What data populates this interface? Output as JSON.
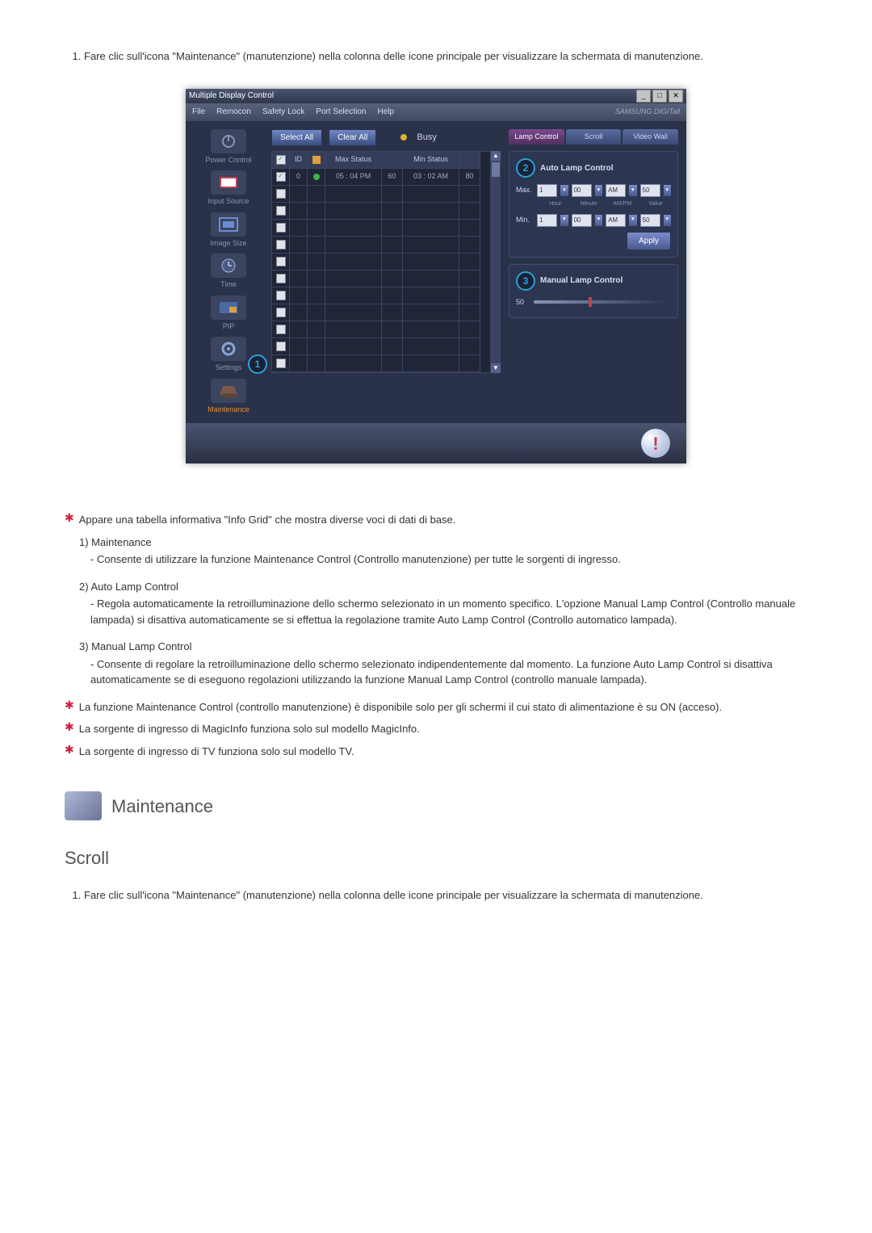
{
  "intro_steps": [
    "Fare clic sull'icona \"Maintenance\" (manutenzione) nella colonna delle icone principale per visualizzare la schermata di manutenzione."
  ],
  "app": {
    "title": "Multiple Display Control",
    "menus": [
      "File",
      "Remocon",
      "Safety Lock",
      "Port Selection",
      "Help"
    ],
    "brand": "SAMSUNG DIGITall"
  },
  "sidebar": {
    "items": [
      {
        "label": "Power Control"
      },
      {
        "label": "Input Source"
      },
      {
        "label": "Image Size"
      },
      {
        "label": "Time"
      },
      {
        "label": "PIP"
      },
      {
        "label": "Settings"
      },
      {
        "label": "Maintenance"
      }
    ]
  },
  "toolbar": {
    "select_all": "Select All",
    "clear_all": "Clear All",
    "busy": "Busy"
  },
  "grid": {
    "headers": {
      "check": "",
      "id": "ID",
      "stat": "",
      "maxstat": "Max Status",
      "maxval": "",
      "minstat": "Min Status",
      "minval": ""
    },
    "row1": {
      "id": "0",
      "maxstat": "05 : 04 PM",
      "maxval": "60",
      "minstat": "03 : 02 AM",
      "minval": "80"
    }
  },
  "tabs": {
    "lamp": "Lamp Control",
    "scroll": "Scroll",
    "video": "Video Wall"
  },
  "auto_panel": {
    "title": "Auto Lamp Control",
    "max_lbl": "Max.",
    "min_lbl": "Min.",
    "hour": "1",
    "minute": "00",
    "ampm": "AM",
    "value_max": "50",
    "value_min": "50",
    "sub_hour": "Hour",
    "sub_minute": "Minute",
    "sub_ampm": "AM/PM",
    "sub_value": "Value",
    "apply": "Apply"
  },
  "manual_panel": {
    "title": "Manual Lamp Control",
    "value": "50"
  },
  "callouts": {
    "one": "1",
    "two": "2",
    "three": "3"
  },
  "below": {
    "star1": "Appare una tabella informativa \"Info Grid\" che mostra diverse voci di dati di base.",
    "n1_title": "Maintenance",
    "n1_body": "Consente di utilizzare la funzione Maintenance Control (Controllo manutenzione) per tutte le sorgenti di ingresso.",
    "n2_title": "Auto Lamp Control",
    "n2_body": "Regola automaticamente la retroilluminazione dello schermo selezionato in un momento specifico. L'opzione Manual Lamp Control (Controllo manuale lampada) si disattiva automaticamente se si effettua la regolazione tramite Auto Lamp Control (Controllo automatico lampada).",
    "n3_title": "Manual Lamp Control",
    "n3_body": "Consente di regolare la retroilluminazione dello schermo selezionato indipendentemente dal momento. La funzione Auto Lamp Control si disattiva automaticamente se di eseguono regolazioni utilizzando la funzione Manual Lamp Control (controllo manuale lampada).",
    "star2": "La funzione Maintenance Control (controllo manutenzione) è disponibile solo per gli schermi il cui stato di alimentazione è su ON (acceso).",
    "star3": "La sorgente di ingresso di MagicInfo funziona solo sul modello MagicInfo.",
    "star4": "La sorgente di ingresso di TV funziona solo sul modello TV."
  },
  "section2": {
    "heading": "Maintenance",
    "sub": "Scroll"
  },
  "outro_steps": [
    "Fare clic sull'icona \"Maintenance\" (manutenzione) nella colonna delle icone principale per visualizzare la schermata di manutenzione."
  ]
}
